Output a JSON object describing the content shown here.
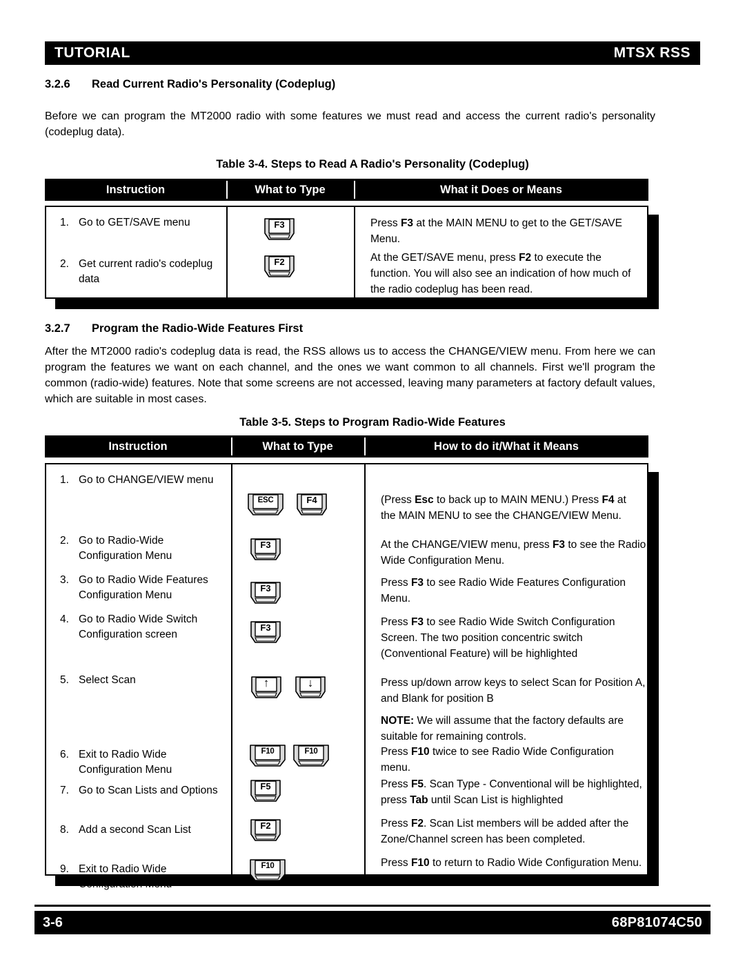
{
  "running_header": {
    "left": "TUTORIAL",
    "right": "MTSX RSS"
  },
  "running_footer": {
    "page_number": "3-6",
    "document_number": "68P81074C50"
  },
  "sections": [
    {
      "number": "3.2.6",
      "title": "Read Current Radio's Personality (Codeplug)",
      "paragraph": "Before we can program the MT2000 radio with some features we must read and access the current radio's personality (codeplug data)."
    },
    {
      "number": "3.2.7",
      "title": "Program the Radio-Wide Features First",
      "paragraph": "After the MT2000 radio's codeplug data is read, the RSS allows us to access the CHANGE/VIEW menu.  From here we can program the features we want on each channel, and the ones we want common to all channels.  First we'll program the common (radio-wide) features.  Note that some screens are not accessed, leaving many parameters at factory default values, which are suitable in most cases."
    }
  ],
  "table_3_4": {
    "caption": "Table 3-4.  Steps to Read A Radio's Personality (Codeplug)",
    "columns": [
      "Instruction",
      "What to Type",
      "What it Does or Means"
    ],
    "rows": [
      {
        "number": "1.",
        "instruction": "Go to GET/SAVE menu",
        "keys": [
          "F3"
        ],
        "description_html": "Press <b>F3</b> at the MAIN MENU to get to the GET/SAVE Menu."
      },
      {
        "number": "2.",
        "instruction": "Get current radio's codeplug data",
        "keys": [
          "F2"
        ],
        "description_html": "At the GET/SAVE menu, press <b>F2</b> to execute the function.  You will also see an indication of how much of the radio codeplug has been read."
      }
    ]
  },
  "table_3_5": {
    "caption": "Table 3-5.  Steps to Program Radio-Wide Features",
    "columns": [
      "Instruction",
      "What to Type",
      "How to do it/What it Means"
    ],
    "rows": [
      {
        "number": "1.",
        "instruction": "Go to CHANGE/VIEW menu",
        "keys": [
          "ESC",
          "F4"
        ],
        "description_html": "(Press <b>Esc</b> to back up to MAIN MENU.)  Press <b>F4</b> at the MAIN MENU to see the CHANGE/VIEW Menu."
      },
      {
        "number": "2.",
        "instruction": "Go to Radio-Wide Configuration Menu",
        "keys": [
          "F3"
        ],
        "description_html": "At the CHANGE/VIEW menu, press <b>F3</b> to see the Radio Wide Configuration Menu."
      },
      {
        "number": "3.",
        "instruction": "Go to Radio Wide Features Configuration Menu",
        "keys": [
          "F3"
        ],
        "description_html": "Press <b>F3</b> to see Radio Wide Features Configuration Menu."
      },
      {
        "number": "4.",
        "instruction": "Go to Radio Wide Switch Configuration screen",
        "keys": [
          "F3"
        ],
        "description_html": "Press <b>F3</b> to see Radio Wide Switch Configuration Screen.  The two position concentric switch (Conventional Feature) will be highlighted"
      },
      {
        "number": "5.",
        "instruction": "Select Scan",
        "keys": [
          "↑",
          "↓"
        ],
        "description_html": "Press up/down arrow keys to select Scan for Position A, and Blank for position B"
      },
      {
        "number": "",
        "instruction": "",
        "keys": [],
        "description_html": "<b>NOTE:</b>  We will assume that the factory defaults are suitable for remaining controls."
      },
      {
        "number": "6.",
        "instruction": "Exit to Radio Wide Configuration Menu",
        "keys": [
          "F10",
          "F10"
        ],
        "description_html": "Press <b>F10</b> twice to see Radio Wide Configuration menu."
      },
      {
        "number": "7.",
        "instruction": "Go to Scan Lists and Options",
        "keys": [
          "F5"
        ],
        "description_html": "Press <b>F5</b>. Scan Type - Conventional will be highlighted, press <b>Tab</b> until Scan List is highlighted"
      },
      {
        "number": "8.",
        "instruction": "Add a second Scan List",
        "keys": [
          "F2"
        ],
        "description_html": "Press <b>F2</b>.  Scan List members will be added after the Zone/Channel screen has been completed."
      },
      {
        "number": "9.",
        "instruction": "Exit to Radio Wide Configuration Menu",
        "keys": [
          "F10"
        ],
        "description_html": "Press <b>F10</b> to return to Radio Wide Configuration Menu."
      }
    ]
  },
  "colors": {
    "ink": "#000000",
    "paper": "#ffffff",
    "key_face": "#ffffff",
    "key_shade": "#d9d9d9"
  }
}
